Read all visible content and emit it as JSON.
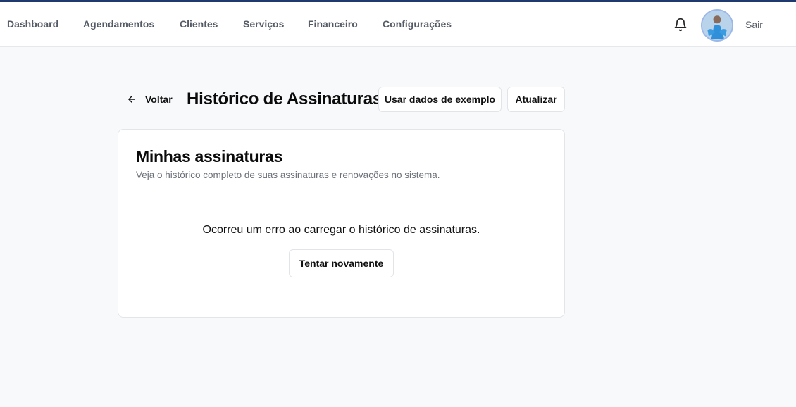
{
  "nav": {
    "items": [
      {
        "label": "Dashboard"
      },
      {
        "label": "Agendamentos"
      },
      {
        "label": "Clientes"
      },
      {
        "label": "Serviços"
      },
      {
        "label": "Financeiro"
      },
      {
        "label": "Configurações"
      }
    ],
    "logout_label": "Sair",
    "notification_icon": "bell-icon",
    "accent_color": "#1e3a6e"
  },
  "header": {
    "back_label": "Voltar",
    "title": "Histórico de Assinaturas",
    "sample_data_button": "Usar dados de exemplo",
    "refresh_button": "Atualizar"
  },
  "card": {
    "title": "Minhas assinaturas",
    "description": "Veja o histórico completo de suas assinaturas e renovações no sistema.",
    "error_message": "Ocorreu um erro ao carregar o histórico de assinaturas.",
    "retry_button": "Tentar novamente"
  }
}
